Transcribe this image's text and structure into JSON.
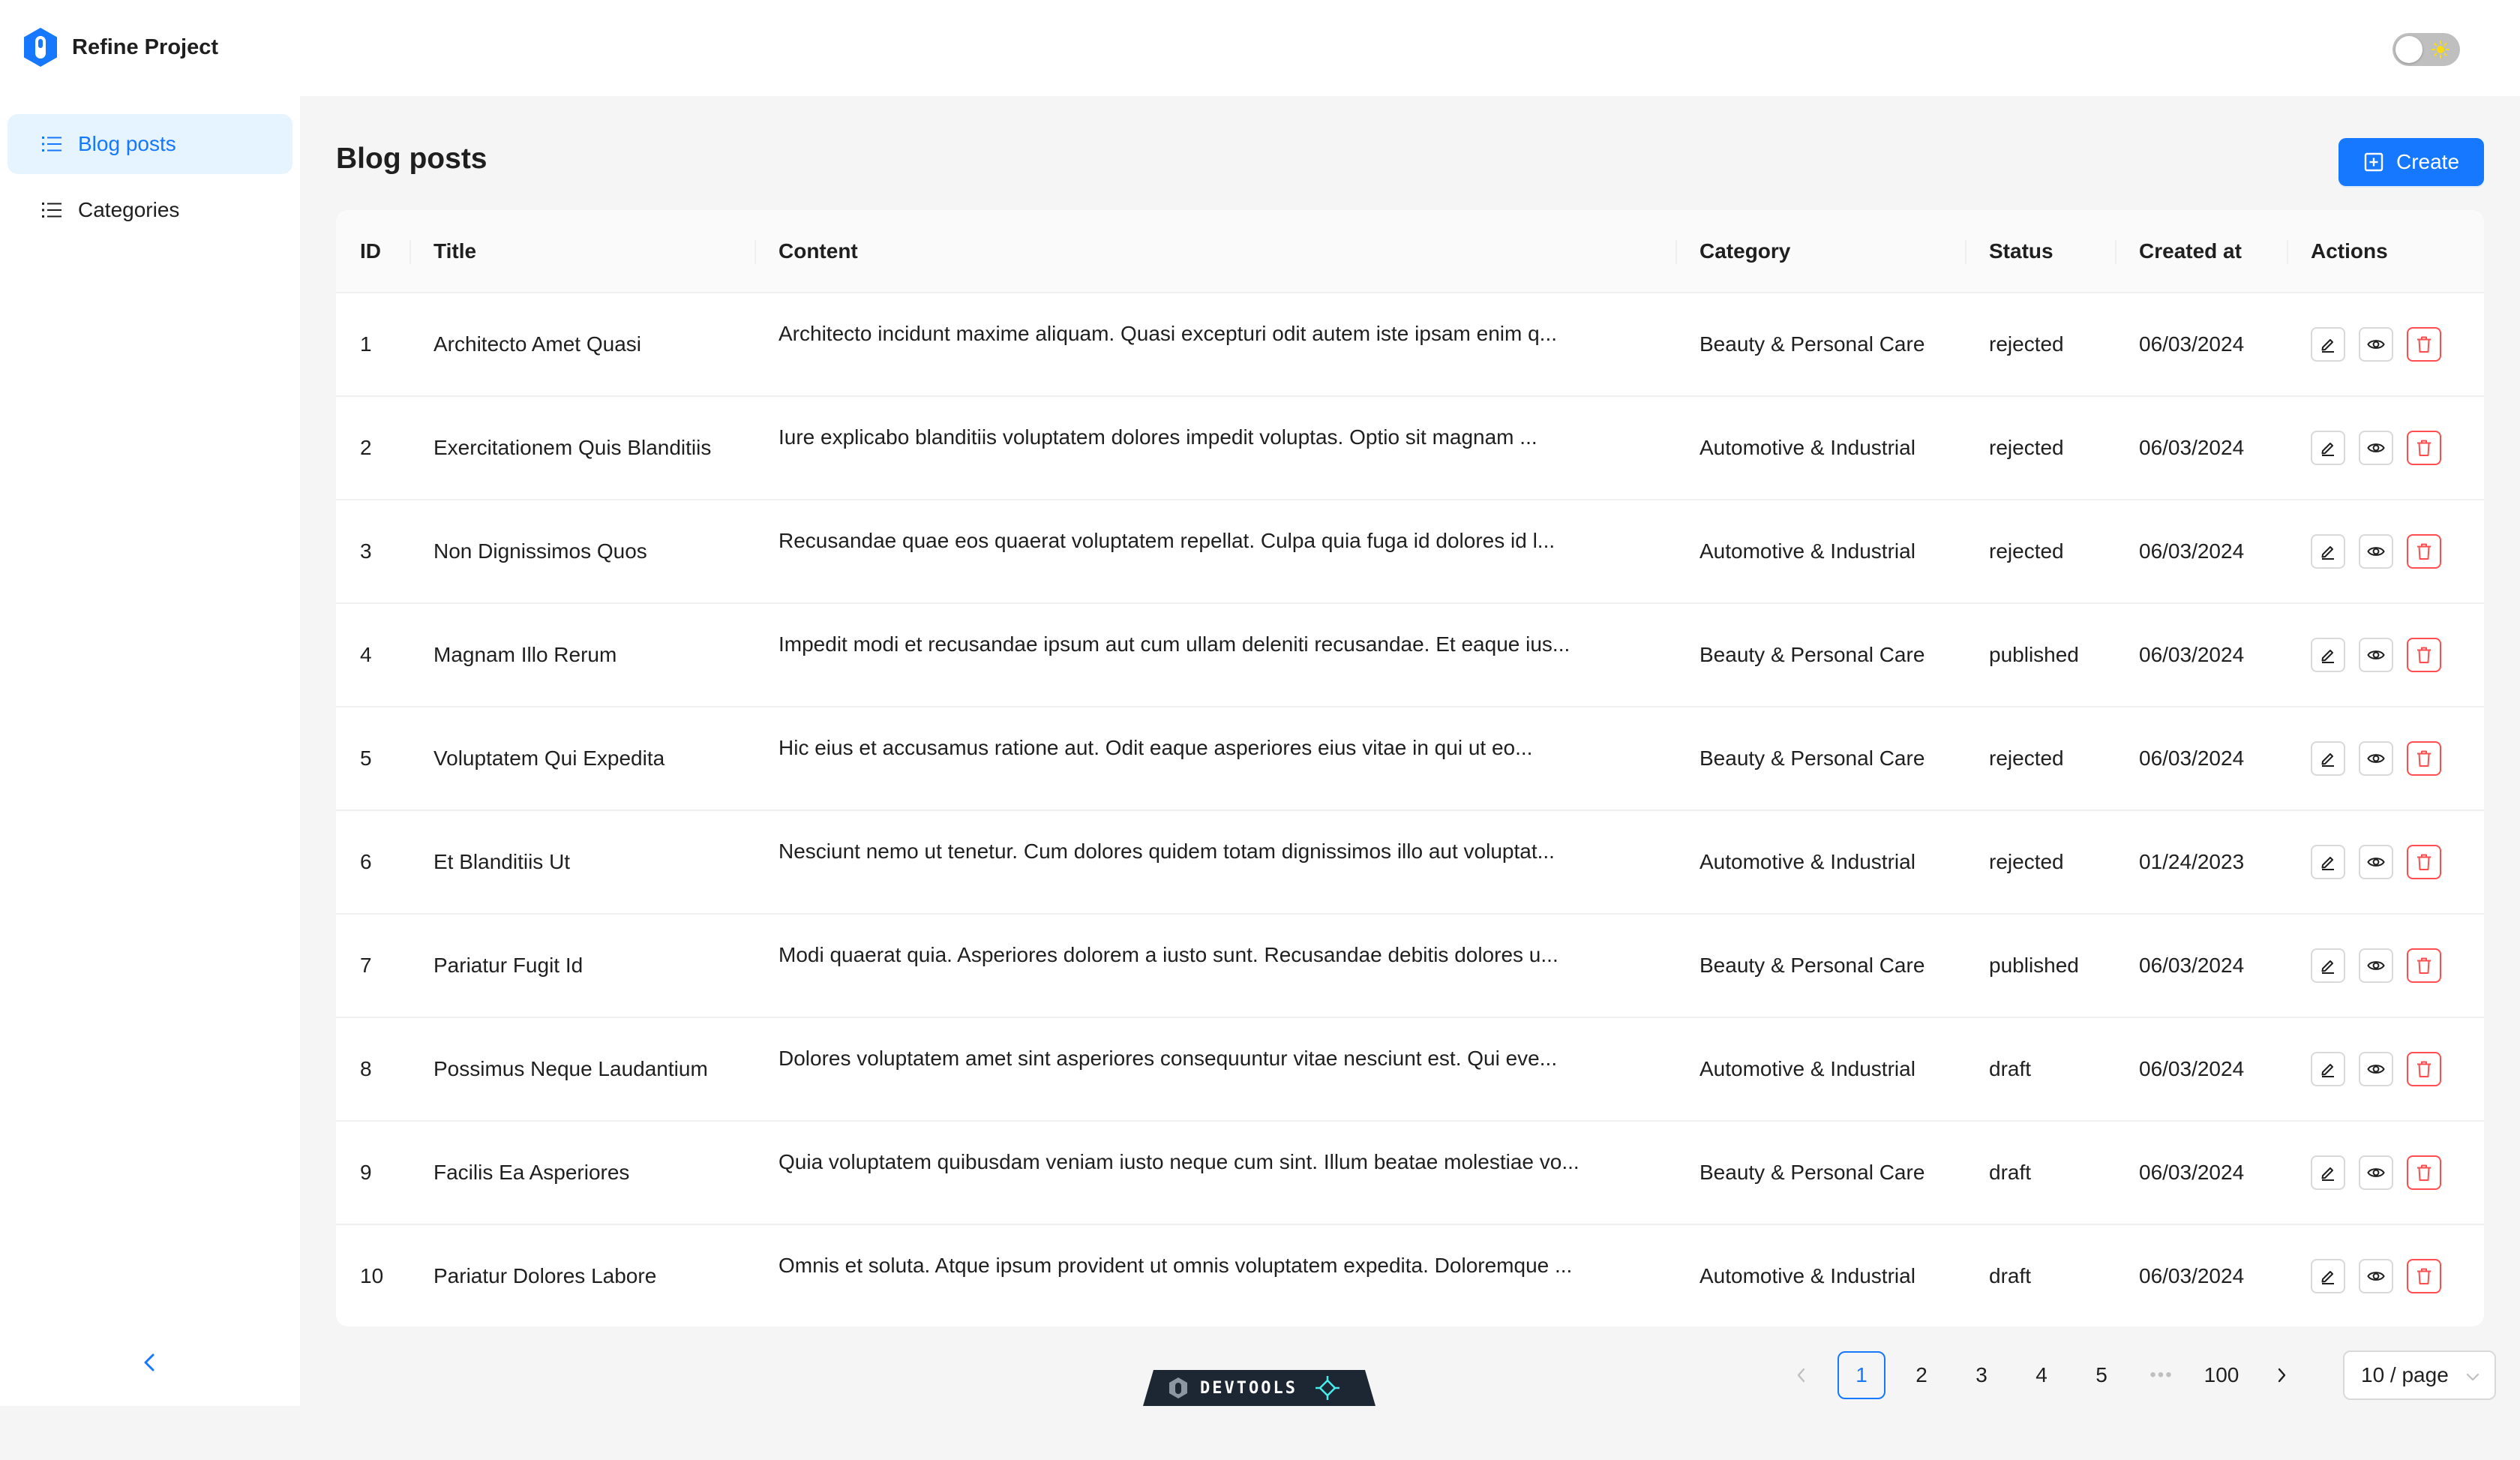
{
  "app": {
    "name": "Refine Project"
  },
  "theme_toggle": {
    "state": "light"
  },
  "sidebar": {
    "items": [
      {
        "label": "Blog posts",
        "active": true
      },
      {
        "label": "Categories",
        "active": false
      }
    ],
    "collapse_icon": "chevron-left-icon"
  },
  "page": {
    "title": "Blog posts",
    "create_label": "Create"
  },
  "table": {
    "columns": [
      "ID",
      "Title",
      "Content",
      "Category",
      "Status",
      "Created at",
      "Actions"
    ],
    "rows": [
      {
        "id": "1",
        "title": "Architecto Amet Quasi",
        "content": "Architecto incidunt maxime aliquam. Quasi excepturi odit autem iste ipsam enim q...",
        "category": "Beauty & Personal Care",
        "status": "rejected",
        "created_at": "06/03/2024"
      },
      {
        "id": "2",
        "title": "Exercitationem Quis Blanditiis",
        "content": "Iure explicabo blanditiis voluptatem dolores impedit voluptas. Optio sit magnam ...",
        "category": "Automotive & Industrial",
        "status": "rejected",
        "created_at": "06/03/2024"
      },
      {
        "id": "3",
        "title": "Non Dignissimos Quos",
        "content": "Recusandae quae eos quaerat voluptatem repellat. Culpa quia fuga id dolores id l...",
        "category": "Automotive & Industrial",
        "status": "rejected",
        "created_at": "06/03/2024"
      },
      {
        "id": "4",
        "title": "Magnam Illo Rerum",
        "content": "Impedit modi et recusandae ipsum aut cum ullam deleniti recusandae. Et eaque ius...",
        "category": "Beauty & Personal Care",
        "status": "published",
        "created_at": "06/03/2024"
      },
      {
        "id": "5",
        "title": "Voluptatem Qui Expedita",
        "content": "Hic eius et accusamus ratione aut. Odit eaque asperiores eius vitae in qui ut eo...",
        "category": "Beauty & Personal Care",
        "status": "rejected",
        "created_at": "06/03/2024"
      },
      {
        "id": "6",
        "title": "Et Blanditiis Ut",
        "content": "Nesciunt nemo ut tenetur. Cum dolores quidem totam dignissimos illo aut voluptat...",
        "category": "Automotive & Industrial",
        "status": "rejected",
        "created_at": "01/24/2023"
      },
      {
        "id": "7",
        "title": "Pariatur Fugit Id",
        "content": "Modi quaerat quia. Asperiores dolorem a iusto sunt. Recusandae debitis dolores u...",
        "category": "Beauty & Personal Care",
        "status": "published",
        "created_at": "06/03/2024"
      },
      {
        "id": "8",
        "title": "Possimus Neque Laudantium",
        "content": "Dolores voluptatem amet sint asperiores consequuntur vitae nesciunt est. Qui eve...",
        "category": "Automotive & Industrial",
        "status": "draft",
        "created_at": "06/03/2024"
      },
      {
        "id": "9",
        "title": "Facilis Ea Asperiores",
        "content": "Quia voluptatem quibusdam veniam iusto neque cum sint. Illum beatae molestiae vo...",
        "category": "Beauty & Personal Care",
        "status": "draft",
        "created_at": "06/03/2024"
      },
      {
        "id": "10",
        "title": "Pariatur Dolores Labore",
        "content": "Omnis et soluta. Atque ipsum provident ut omnis voluptatem expedita. Doloremque ...",
        "category": "Automotive & Industrial",
        "status": "draft",
        "created_at": "06/03/2024"
      }
    ],
    "row_actions": [
      "edit-icon",
      "eye-icon",
      "delete-icon"
    ]
  },
  "pagination": {
    "pages": [
      "1",
      "2",
      "3",
      "4",
      "5"
    ],
    "ellipsis": "•••",
    "last_page": "100",
    "current": "1",
    "page_size": "10 / page"
  },
  "devtools": {
    "label": "DEVTOOLS"
  },
  "colors": {
    "primary": "#1677ff",
    "danger": "#ff4d4f",
    "devtools_bg": "#1d2733",
    "devtools_accent": "#47ebeb"
  }
}
